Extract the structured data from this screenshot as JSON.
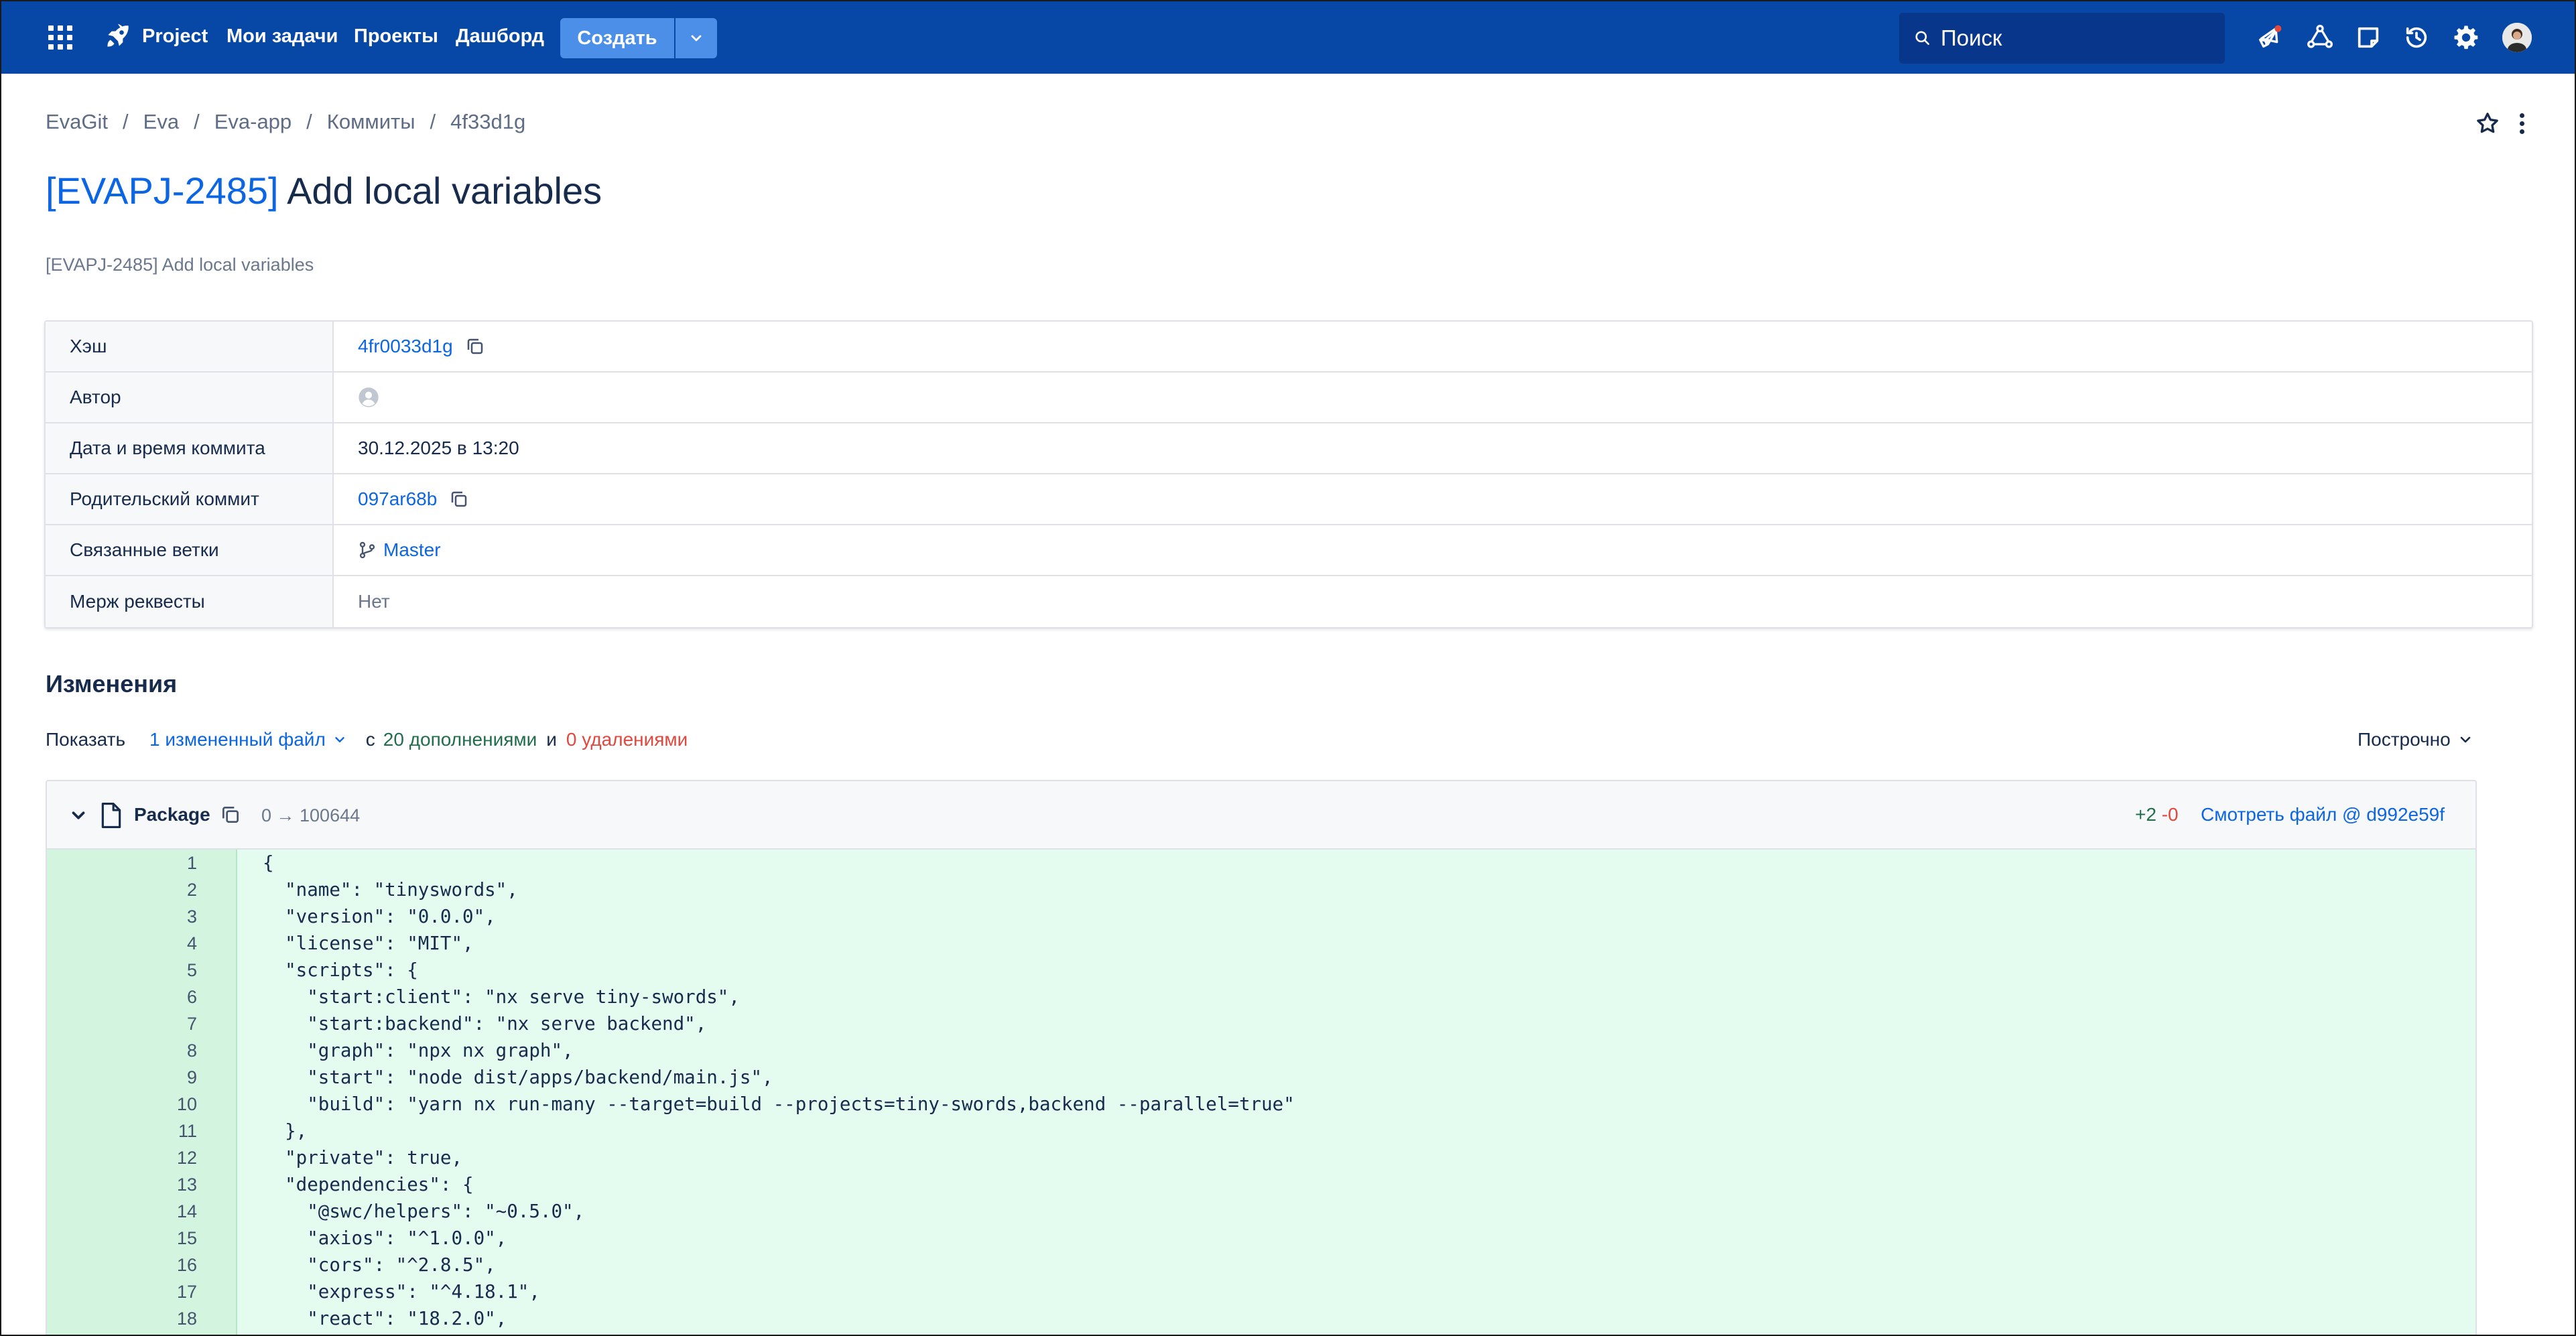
{
  "topbar": {
    "logo_text": "Project",
    "nav": [
      "Мои задачи",
      "Проекты",
      "Дашборд"
    ],
    "create_label": "Создать",
    "search_placeholder": "Поиск",
    "bg_color": "#0747a6"
  },
  "breadcrumb": [
    "EvaGit",
    "Eva",
    "Eva-app",
    "Коммиты",
    "4f33d1g"
  ],
  "title": {
    "issue_key": "[EVAPJ-2485]",
    "text": " Add local variables"
  },
  "subtitle": "[EVAPJ-2485] Add local variables",
  "info": {
    "hash_label": "Хэш",
    "hash_value": "4fr0033d1g",
    "author_label": "Автор",
    "date_label": "Дата и время коммита",
    "date_value": "30.12.2025 в 13:20",
    "parent_label": "Родительский коммит",
    "parent_value": "097ar68b",
    "branches_label": "Связанные ветки",
    "branch_value": "Master",
    "mr_label": "Мерж реквесты",
    "mr_value": "Нет"
  },
  "changes": {
    "heading": "Изменения",
    "show_label": "Показать",
    "files_dropdown": "1 измененный файл",
    "with_label": "с",
    "additions": "20 дополнениями",
    "and_label": "и",
    "deletions": "0 удалениями",
    "view_mode": "Построчно"
  },
  "file": {
    "name": "Package",
    "mode": "0 → 100644",
    "added": "+2",
    "removed": "-0",
    "view_file": "Смотреть файл @ d992e59f"
  },
  "code_lines": [
    {
      "n": "1",
      "t": "{"
    },
    {
      "n": "2",
      "t": "  \"name\": \"tinyswords\","
    },
    {
      "n": "3",
      "t": "  \"version\": \"0.0.0\","
    },
    {
      "n": "4",
      "t": "  \"license\": \"MIT\","
    },
    {
      "n": "5",
      "t": "  \"scripts\": {"
    },
    {
      "n": "6",
      "t": "    \"start:client\": \"nx serve tiny-swords\","
    },
    {
      "n": "7",
      "t": "    \"start:backend\": \"nx serve backend\","
    },
    {
      "n": "8",
      "t": "    \"graph\": \"npx nx graph\","
    },
    {
      "n": "9",
      "t": "    \"start\": \"node dist/apps/backend/main.js\","
    },
    {
      "n": "10",
      "t": "    \"build\": \"yarn nx run-many --target=build --projects=tiny-swords,backend --parallel=true\""
    },
    {
      "n": "11",
      "t": "  },"
    },
    {
      "n": "12",
      "t": "  \"private\": true,"
    },
    {
      "n": "13",
      "t": "  \"dependencies\": {"
    },
    {
      "n": "14",
      "t": "    \"@swc/helpers\": \"~0.5.0\","
    },
    {
      "n": "15",
      "t": "    \"axios\": \"^1.0.0\","
    },
    {
      "n": "16",
      "t": "    \"cors\": \"^2.8.5\","
    },
    {
      "n": "17",
      "t": "    \"express\": \"^4.18.1\","
    },
    {
      "n": "18",
      "t": "    \"react\": \"18.2.0\","
    }
  ]
}
